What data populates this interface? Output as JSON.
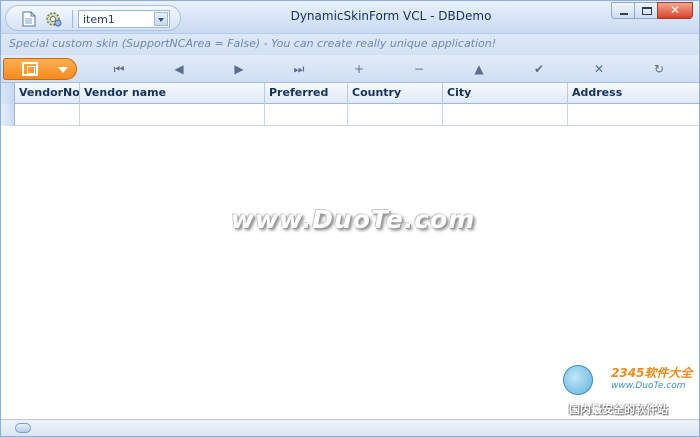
{
  "window": {
    "title": "DynamicSkinForm VCL - DBDemo",
    "subtitle": "Special custom skin (SupportNCArea = False) - You can create really unique application!"
  },
  "quick_access": {
    "combo_value": "item1",
    "icons": [
      "document-icon",
      "gear-icon"
    ]
  },
  "window_controls": [
    "minimize-icon",
    "maximize-icon",
    "close-icon"
  ],
  "toolbar": {
    "menu_icon": "grid-menu-icon",
    "navigator": [
      {
        "name": "first-record",
        "glyph": "⏮"
      },
      {
        "name": "prior-record",
        "glyph": "◀"
      },
      {
        "name": "next-record",
        "glyph": "▶"
      },
      {
        "name": "last-record",
        "glyph": "⏭"
      },
      {
        "name": "insert-record",
        "glyph": "+"
      },
      {
        "name": "delete-record",
        "glyph": "−"
      },
      {
        "name": "edit-record",
        "glyph": "▲"
      },
      {
        "name": "post-record",
        "glyph": "✔"
      },
      {
        "name": "cancel-record",
        "glyph": "✕"
      },
      {
        "name": "refresh-records",
        "glyph": "↻"
      }
    ]
  },
  "grid": {
    "columns": [
      "VendorNo",
      "Vendor name",
      "Preferred",
      "Country",
      "City",
      "Address"
    ],
    "rows": [
      [
        "",
        "",
        "",
        "",
        "",
        ""
      ]
    ]
  },
  "watermark": {
    "text": "www.DuoTe.com",
    "logo_brand": "2345软件大全",
    "logo_url": "www.DuoTe.com",
    "logo_slogan": "国内最安全的软件站"
  }
}
